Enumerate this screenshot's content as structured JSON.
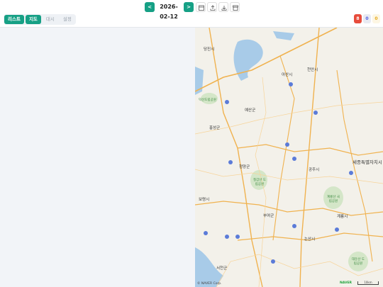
{
  "toolbar": {
    "prev_label": "<",
    "date": "2026-02-12",
    "next_label": ">"
  },
  "tabs": [
    {
      "label": "리스트",
      "active": true
    },
    {
      "label": "지도",
      "active": true
    },
    {
      "label": "대시",
      "active": false
    },
    {
      "label": "설정",
      "active": false
    }
  ],
  "badges": [
    {
      "label": "8",
      "color": "#e74c3c",
      "text_color": "#ffffff"
    },
    {
      "label": "0",
      "color": "#e8eaf2",
      "text_color": "#4a5be0"
    },
    {
      "label": "0",
      "color": "#fdf6e3",
      "text_color": "#e6a817"
    }
  ],
  "map": {
    "labels": {
      "dangjin": "당진시",
      "asan": "아산시",
      "cheonan": "천안시",
      "hongseong": "홍성군",
      "cheongyang": "청양군",
      "gongju": "공주시",
      "sejong": "세종특별자치시",
      "boryeong": "보령시",
      "buyeo": "부여군",
      "nonsan": "논산시",
      "gyeryong": "계룡시",
      "seocheon": "서천군",
      "yesan": "예산군",
      "deoksan": "덕산도립공원",
      "chilgapsan": "칠갑산 도립공원",
      "gyeryongsan": "계룡산 국립공원",
      "daedunsan": "대둔산 도립공원"
    },
    "copyright": "© NAVER Corp.",
    "logo": "NAVER",
    "scale": "10km"
  },
  "colors": {
    "accent": "#16a085",
    "map_bg": "#f3f1ea",
    "road": "#f5b75c",
    "water": "#9ec3e6",
    "park": "#cfe3c4"
  }
}
